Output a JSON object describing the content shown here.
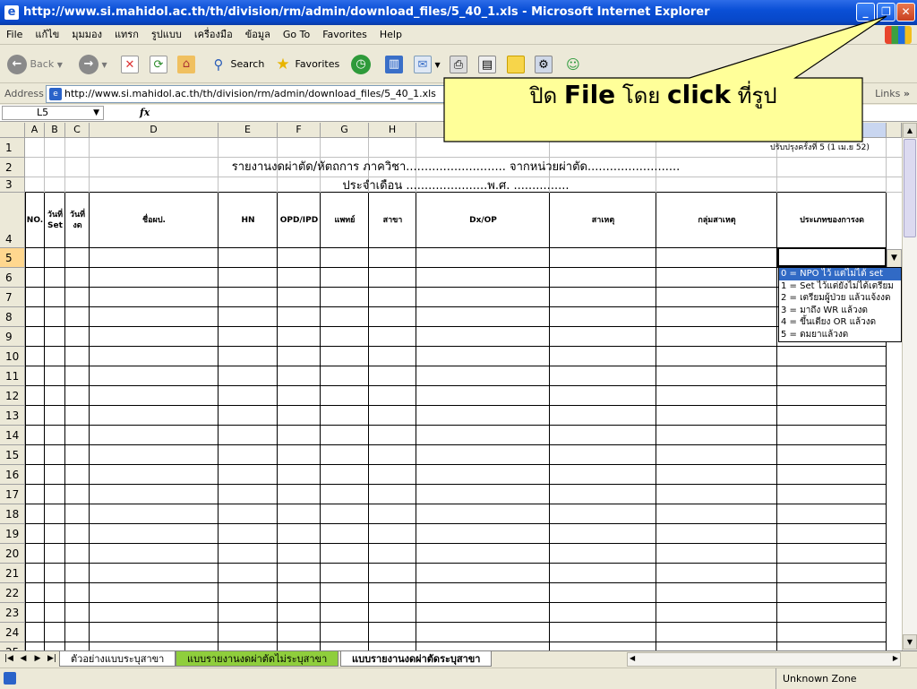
{
  "window": {
    "title": "http://www.si.mahidol.ac.th/th/division/rm/admin/download_files/5_40_1.xls - Microsoft Internet Explorer",
    "icon": "ie-icon"
  },
  "menu": [
    "File",
    "แก้ไข",
    "มุมมอง",
    "แทรก",
    "รูปแบบ",
    "เครื่องมือ",
    "ข้อมูล",
    "Go To",
    "Favorites",
    "Help"
  ],
  "toolbar": {
    "back": "Back",
    "search": "Search",
    "favorites": "Favorites"
  },
  "address": {
    "label": "Address",
    "url": "http://www.si.mahidol.ac.th/th/division/rm/admin/download_files/5_40_1.xls",
    "links": "Links"
  },
  "formula": {
    "cell_ref": "L5",
    "fx": "fx"
  },
  "sheet": {
    "columns": [
      "A",
      "B",
      "C",
      "D",
      "E",
      "F",
      "G",
      "H"
    ],
    "rows": [
      "1",
      "2",
      "3",
      "4",
      "5",
      "6",
      "7",
      "8",
      "9",
      "10",
      "11",
      "12",
      "13",
      "14",
      "15",
      "16",
      "17",
      "18",
      "19",
      "20",
      "21",
      "22",
      "23",
      "24",
      "25"
    ],
    "revision_note": "ปรับปรุงครั้งที่ 5 (1 เม.ย 52)",
    "title_line1": "รายงานงดผ่าตัด/หัตถการ ภาควิชา........................... จากหน่วยผ่าตัด.........................",
    "title_line2": "ประจำเดือน ......................พ.ศ. ...............",
    "headers": [
      {
        "text": "NO.",
        "name": "header-no"
      },
      {
        "text": "วันที่ Set",
        "name": "header-set-date"
      },
      {
        "text": "วันที่งด",
        "name": "header-cancel-date"
      },
      {
        "text": "ชื่อผป.",
        "name": "header-patient-name"
      },
      {
        "text": "HN",
        "name": "header-hn"
      },
      {
        "text": "OPD/IPD",
        "name": "header-opd-ipd"
      },
      {
        "text": "แพทย์",
        "name": "header-doctor"
      },
      {
        "text": "สาขา",
        "name": "header-branch"
      },
      {
        "text": "Dx/OP",
        "name": "header-dx-op"
      },
      {
        "text": "สาเหตุ",
        "name": "header-cause"
      },
      {
        "text": "กลุ่มสาเหตุ",
        "name": "header-cause-group"
      },
      {
        "text": "ประเภทของการงด",
        "name": "header-cancel-type"
      }
    ]
  },
  "dropdown": {
    "options": [
      "0 = NPO ไว้ แต่ไม่ได้ set",
      "1 = Set ไว้แต่ยังไม่ได้เตรียม",
      "2 = เตรียมผู้ป่วย แล้วแจ้งงด",
      "3 = มาถึง WR แล้วงด",
      "4 = ขึ้นเตียง OR แล้วงด",
      "5 = ดมยาแล้วงด"
    ],
    "selected_index": 0
  },
  "tabs": [
    "ตัวอย่างแบบระบุสาขา",
    "แบบรายงานงดผ่าตัดไม่ระบุสาขา",
    "แบบรายงานงดผ่าตัดระบุสาขา"
  ],
  "status": {
    "zone": "Unknown Zone"
  },
  "callout": {
    "part1": "ปิด",
    "part2": "File",
    "part3": "โดย",
    "part4": "click",
    "part5": "ที่รูป"
  },
  "colors": {
    "title_bar": "#0a4fd6",
    "callout_bg": "#ffff99",
    "selected_row_header": "#ffd78e",
    "active_tab_green": "#8fce3c",
    "dropdown_selected": "#316ac5"
  }
}
